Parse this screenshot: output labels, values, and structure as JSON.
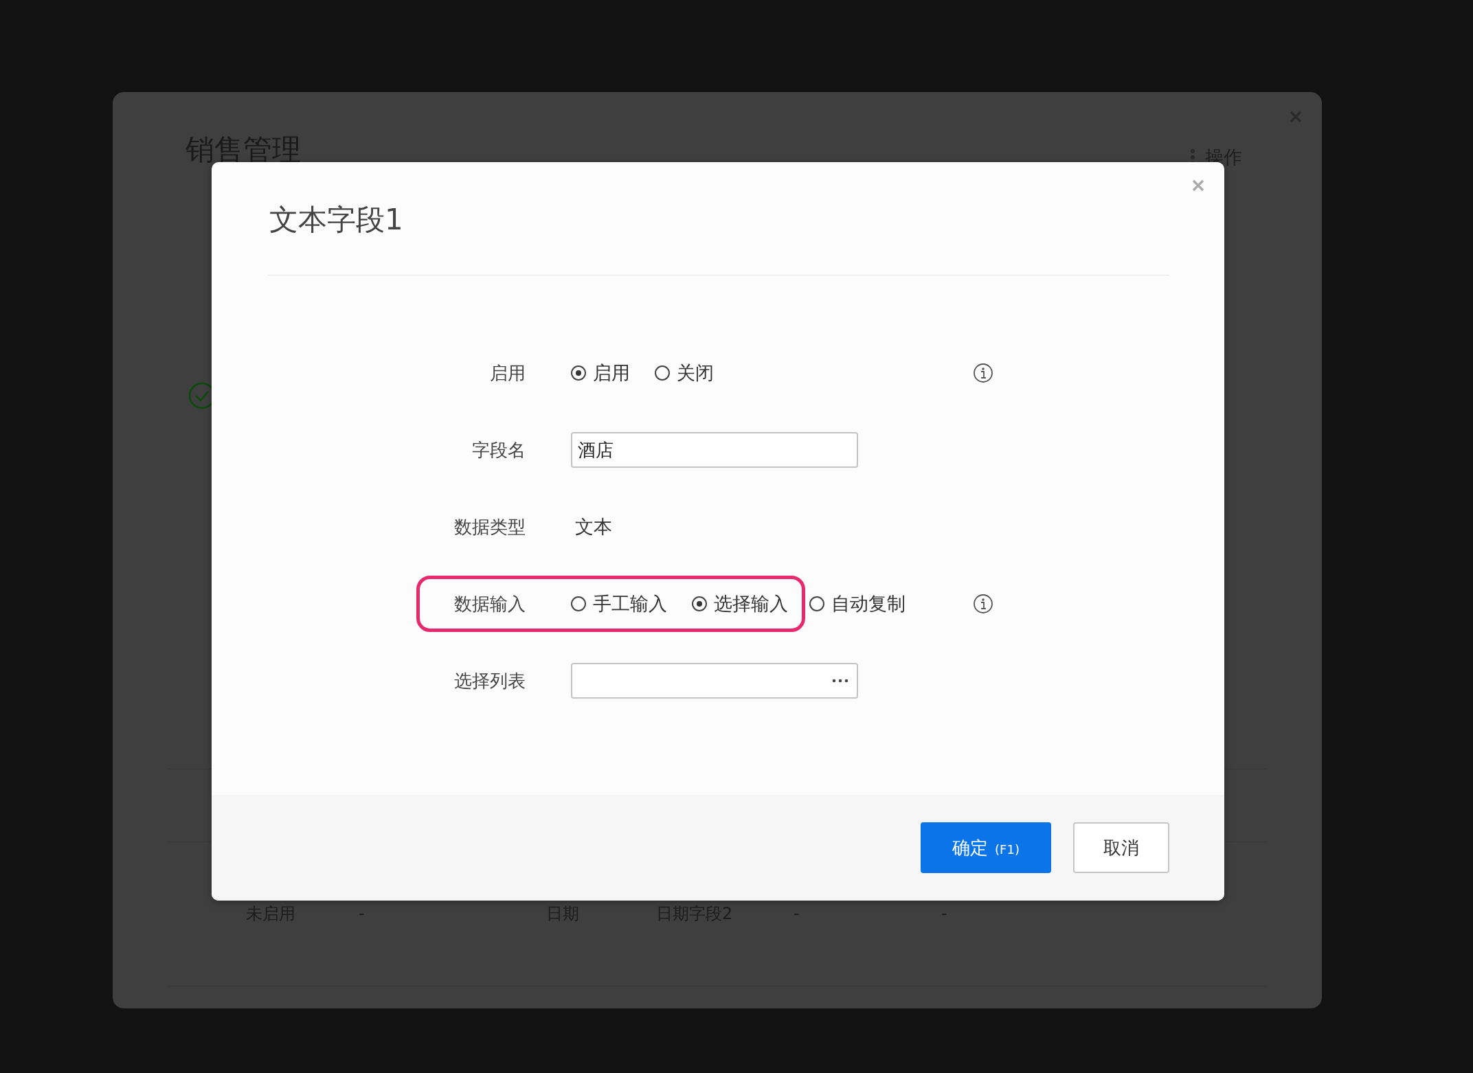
{
  "background_window": {
    "title": "销售管理",
    "actions_label": "操作",
    "table_rows": [
      {
        "cells": [
          "未启用",
          "-",
          "日期",
          "日期字段2",
          "-",
          "-"
        ]
      }
    ]
  },
  "dialog": {
    "title": "文本字段1",
    "fields": [
      {
        "kind": "radio",
        "label": "启用",
        "options": [
          {
            "label": "启用",
            "selected": true
          },
          {
            "label": "关闭",
            "selected": false
          }
        ],
        "info": true
      },
      {
        "kind": "input",
        "label": "字段名",
        "value": "酒店"
      },
      {
        "kind": "text",
        "label": "数据类型",
        "value": "文本"
      },
      {
        "kind": "radio",
        "label": "数据输入",
        "highlighted": true,
        "options": [
          {
            "label": "手工输入",
            "selected": false
          },
          {
            "label": "选择输入",
            "selected": true
          },
          {
            "label": "自动复制",
            "selected": false
          }
        ],
        "info": true
      },
      {
        "kind": "picker",
        "label": "选择列表"
      }
    ],
    "buttons": [
      {
        "kind": "primary",
        "label": "确定",
        "shortcut": "(F1)"
      },
      {
        "kind": "secondary",
        "label": "取消"
      }
    ]
  }
}
